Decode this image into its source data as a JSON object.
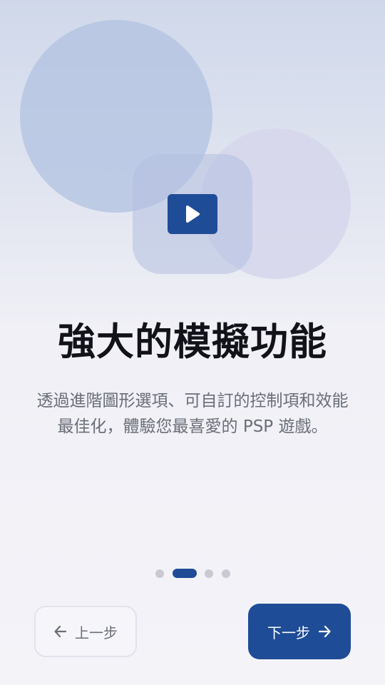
{
  "hero": {
    "icon": "play-icon",
    "accent_color": "#1f4c97"
  },
  "title": "強大的模擬功能",
  "description": "透過進階圖形選項、可自訂的控制項和效能最佳化，體驗您最喜愛的 PSP 遊戲。",
  "pagination": {
    "total": 4,
    "current": 2
  },
  "buttons": {
    "prev_label": "上一步",
    "prev_icon": "arrow-left-icon",
    "next_label": "下一步",
    "next_icon": "arrow-right-icon"
  }
}
